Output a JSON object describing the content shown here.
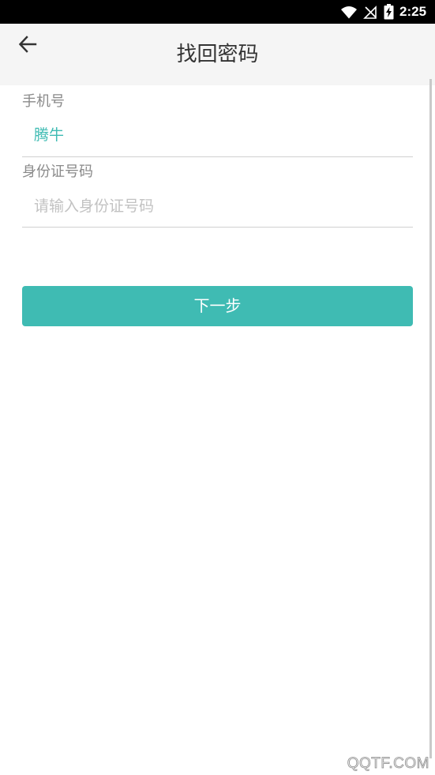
{
  "status_bar": {
    "time": "2:25",
    "icons": [
      "wifi-icon",
      "no-signal-icon",
      "battery-charging-icon"
    ]
  },
  "header": {
    "back_icon": "arrow-left-icon",
    "title": "找回密码"
  },
  "form": {
    "phone": {
      "label": "手机号",
      "value": "腾牛"
    },
    "id_card": {
      "label": "身份证号码",
      "value": "",
      "placeholder": "请输入身份证号码"
    }
  },
  "next_button": {
    "label": "下一步"
  },
  "watermark": "QQTF.COM",
  "colors": {
    "accent": "#3fbbb3",
    "header_bg": "#f5f5f5",
    "divider": "#d0d0d0"
  }
}
